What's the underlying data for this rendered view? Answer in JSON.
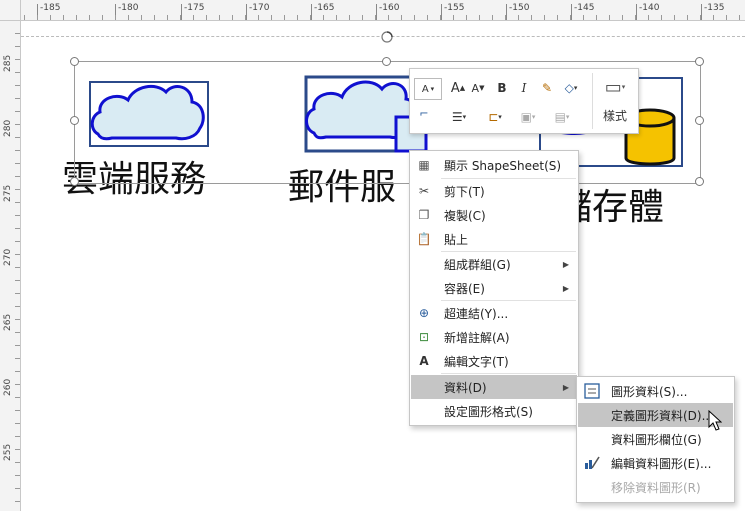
{
  "ruler": {
    "top_labels": [
      "-185",
      "-180",
      "-175",
      "-170",
      "-165",
      "-160",
      "-155",
      "-150",
      "-145",
      "-140",
      "-135"
    ],
    "left_labels": [
      "285",
      "280",
      "275",
      "270",
      "265",
      "260",
      "255"
    ]
  },
  "shapes": [
    {
      "label": "雲端服務"
    },
    {
      "label": "郵件服"
    },
    {
      "label": "儲存體"
    }
  ],
  "mini_toolbar": {
    "style_label": "樣式"
  },
  "context_menu": {
    "items": [
      {
        "label": "顯示 ShapeSheet(S)",
        "icon": "shapesheet-icon"
      },
      {
        "label": "剪下(T)",
        "icon": "scissors-icon"
      },
      {
        "label": "複製(C)",
        "icon": "copy-icon"
      },
      {
        "label": "貼上",
        "icon": "paste-icon"
      },
      {
        "label": "組成群組(G)",
        "icon": "",
        "submenu": true
      },
      {
        "label": "容器(E)",
        "icon": "",
        "submenu": true
      },
      {
        "label": "超連結(Y)...",
        "icon": "hyperlink-icon"
      },
      {
        "label": "新增註解(A)",
        "icon": "comment-icon"
      },
      {
        "label": "編輯文字(T)",
        "icon": "text-icon"
      },
      {
        "label": "資料(D)",
        "icon": "",
        "submenu": true,
        "highlighted": true
      },
      {
        "label": "設定圖形格式(S)",
        "icon": ""
      }
    ]
  },
  "data_submenu": {
    "items": [
      {
        "label": "圖形資料(S)...",
        "icon": "shape-data-icon"
      },
      {
        "label": "定義圖形資料(D)...",
        "highlighted": true
      },
      {
        "label": "資料圖形欄位(G)"
      },
      {
        "label": "編輯資料圖形(E)...",
        "icon": "edit-data-graphic-icon"
      },
      {
        "label": "移除資料圖形(R)",
        "disabled": true
      }
    ]
  },
  "colors": {
    "shape_fill": "#d9ebf3",
    "shape_stroke": "#1010d0",
    "shape_frame": "#2b4a8a",
    "cylinder": "#f5c200",
    "menu_highlight": "#c5c5c5"
  }
}
